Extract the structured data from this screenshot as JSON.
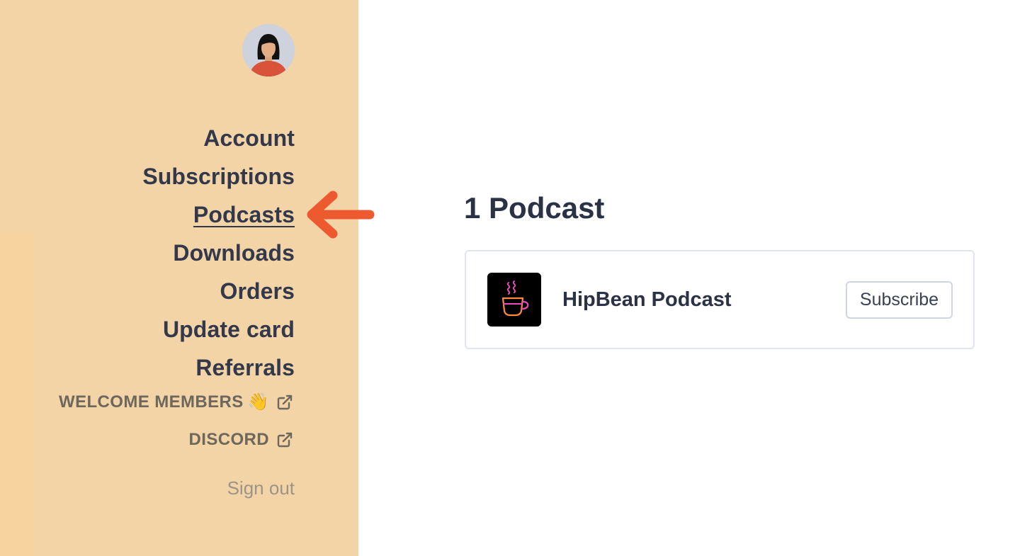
{
  "sidebar": {
    "avatar_icon": "user-avatar",
    "nav": [
      {
        "label": "Account"
      },
      {
        "label": "Subscriptions"
      },
      {
        "label": "Podcasts",
        "active": true
      },
      {
        "label": "Downloads"
      },
      {
        "label": "Orders"
      },
      {
        "label": "Update card"
      },
      {
        "label": "Referrals"
      }
    ],
    "external_links": [
      {
        "label": "WELCOME MEMBERS",
        "emoji": "👋",
        "icon": "external-link-icon"
      },
      {
        "label": "DISCORD",
        "icon": "external-link-icon"
      }
    ],
    "sign_out": "Sign out"
  },
  "annotation": {
    "arrow_icon": "arrow-left-icon",
    "color": "#ee5a30"
  },
  "main": {
    "title": "1 Podcast",
    "podcasts": [
      {
        "title": "HipBean Podcast",
        "art_icon": "coffee-cup-icon",
        "action_label": "Subscribe"
      }
    ]
  },
  "colors": {
    "sidebar_bg": "#f2d4a7",
    "nav_text": "#33384a",
    "heading_text": "#2b3245"
  }
}
